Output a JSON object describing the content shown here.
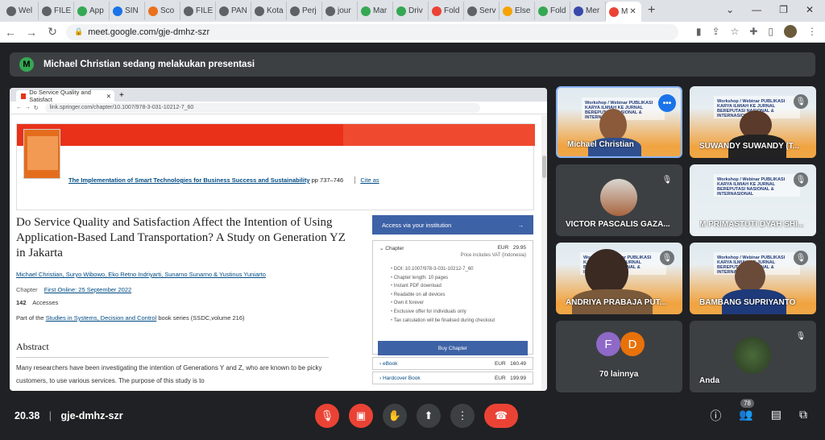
{
  "browser": {
    "tabs": [
      {
        "label": "Wel",
        "icon": "globe-icon",
        "color": "#5f6368"
      },
      {
        "label": "FILE",
        "icon": "globe-icon",
        "color": "#5f6368"
      },
      {
        "label": "App",
        "icon": "drive-icon",
        "color": "#34a853"
      },
      {
        "label": "SIN",
        "icon": "sinta-icon",
        "color": "#1a73e8"
      },
      {
        "label": "Sco",
        "icon": "scopus-icon",
        "color": "#e9711c"
      },
      {
        "label": "FILE",
        "icon": "globe-icon",
        "color": "#5f6368"
      },
      {
        "label": "PAN",
        "icon": "globe-icon",
        "color": "#5f6368"
      },
      {
        "label": "Kota",
        "icon": "globe-icon",
        "color": "#5f6368"
      },
      {
        "label": "Perj",
        "icon": "globe-icon",
        "color": "#5f6368"
      },
      {
        "label": "jour",
        "icon": "globe-icon",
        "color": "#5f6368"
      },
      {
        "label": "Mar",
        "icon": "drive-icon",
        "color": "#34a853"
      },
      {
        "label": "Driv",
        "icon": "drive-icon",
        "color": "#34a853"
      },
      {
        "label": "Fold",
        "icon": "gmail-icon",
        "color": "#ea4335"
      },
      {
        "label": "Serv",
        "icon": "globe-icon",
        "color": "#5f6368"
      },
      {
        "label": "Else",
        "icon": "api-icon",
        "color": "#f4a300"
      },
      {
        "label": "Fold",
        "icon": "drive-icon",
        "color": "#34a853"
      },
      {
        "label": "Mer",
        "icon": "globe-icon",
        "color": "#3949ab"
      },
      {
        "label": "M",
        "icon": "meet-icon",
        "color": "#ea4335",
        "active": true
      }
    ],
    "url": "meet.google.com/gje-dmhz-szr"
  },
  "meet": {
    "presenting_text": "Michael Christian sedang melakukan presentasi",
    "presenter_initial": "M",
    "time": "20.38",
    "meeting_code": "gje-dmhz-szr",
    "participant_count": "78",
    "tiles": [
      {
        "name": "Michael Christian",
        "speaking": true
      },
      {
        "name": "SUWANDY SUWANDY (T...",
        "muted": true
      },
      {
        "name": "VICTOR PASCALIS GAZA...",
        "muted": true
      },
      {
        "name": "M PRIMASTUTI DYAH SHI...",
        "muted": true
      },
      {
        "name": "ANDRIYA PRABAJA PUT...",
        "muted": true
      },
      {
        "name": "BAMBANG SUPRIYANTO",
        "muted": true
      },
      {
        "name": "70 lainnya",
        "initials": [
          "F",
          "D"
        ]
      },
      {
        "name": "Anda",
        "muted": true
      }
    ],
    "ribbon_text": "Workshop / Webinar PUBLIKASI KARYA ILMIAH KE JURNAL BEREPUTASI NASIONAL & INTERNASIONAL"
  },
  "shared": {
    "tab_label": "Do Service Quality and Satisfact",
    "url": "link.springer.com/chapter/10.1007/978-3-031-10212-7_60",
    "book_title": "The Implementation of Smart Technologies for Business Success and Sustainability",
    "book_pages": "pp 737–746",
    "cite_as": "Cite as",
    "article_title": "Do Service Quality and Satisfaction Affect the Intention of Using Application-Based Land Transportation? A Study on Generation YZ in Jakarta",
    "authors": "Michael Christian, Suryo Wibowo, Eko Retno Indriyarti, Sunarno Sunarno & Yustinus Yuniarto",
    "chapter_label": "Chapter",
    "first_online": "First Online: 25 September 2022",
    "accesses_count": "142",
    "accesses_label": "Accesses",
    "series_prefix": "Part of the",
    "series_link": "Studies in Systems, Decision and Control",
    "series_suffix": "book series (SSDC,volume 216)",
    "abstract_heading": "Abstract",
    "abstract_text": "Many researchers have been investigating the intention of Generations Y and Z, who are known to be picky customers, to use various services. The purpose of this study is to",
    "access_button": "Access via your institution",
    "chapter_box": {
      "title": "Chapter",
      "price": "EUR   29.95",
      "vat": "Price includes VAT (Indonesia)",
      "items": [
        "DOI: 10.1007/978-3-031-10212-7_60",
        "Chapter length: 10 pages",
        "Instant PDF download",
        "Readable on all devices",
        "Own it forever",
        "Exclusive offer for individuals only",
        "Tax calculation will be finalised during checkout"
      ],
      "buy": "Buy Chapter"
    },
    "formats": [
      {
        "label": "eBook",
        "price": "EUR   160.49"
      },
      {
        "label": "Hardcover Book",
        "price": "EUR   199.99"
      }
    ]
  }
}
